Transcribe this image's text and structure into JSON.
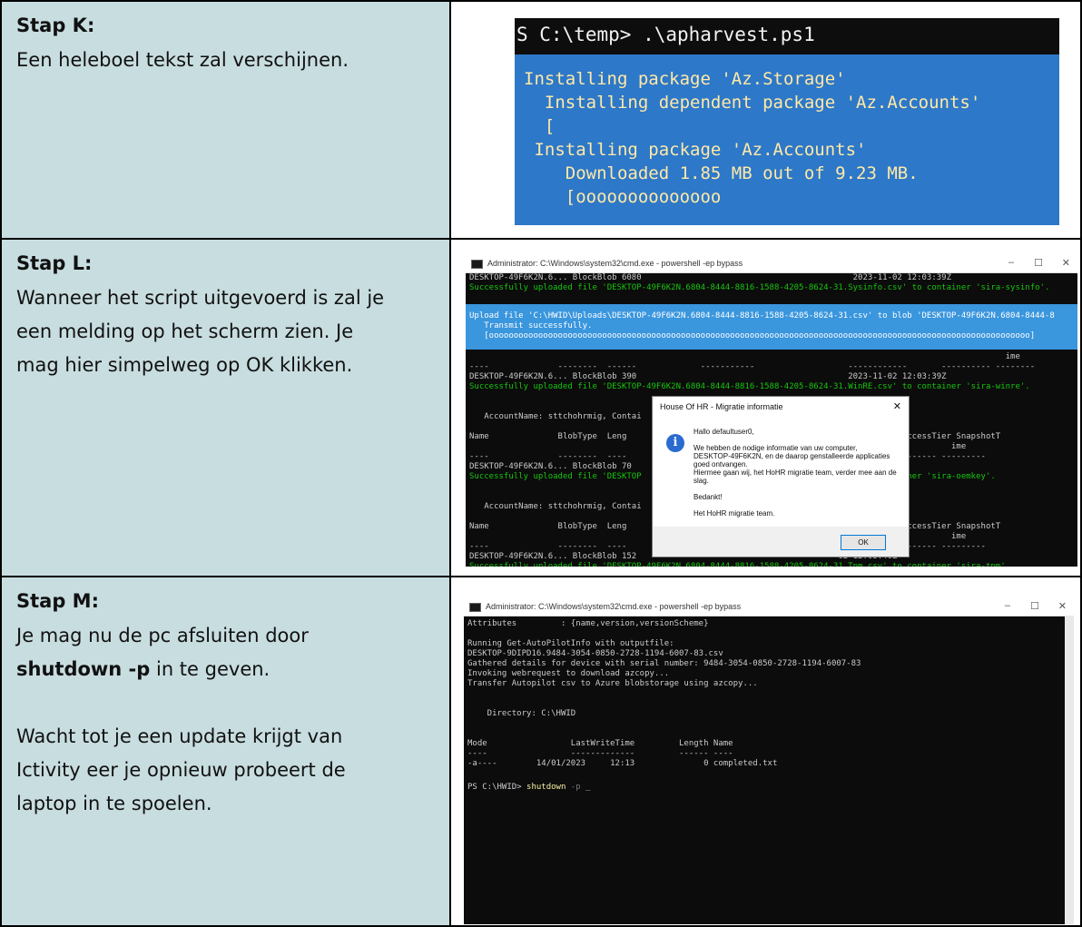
{
  "rows": [
    {
      "title": "Stap K:",
      "text_lines": [
        "Een heleboel tekst zal verschijnen."
      ]
    },
    {
      "title": "Stap L:",
      "text_lines": [
        "Wanneer het script uitgevoerd is zal je",
        "een melding op het scherm zien. Je",
        "mag hier simpelweg op OK klikken."
      ]
    },
    {
      "title": "Stap M:",
      "line1": "Je mag nu de pc afsluiten door",
      "cmd": "shutdown -p",
      "line2_suffix": " in te geven.",
      "para2": [
        "Wacht tot je een update krijgt van",
        "Ictivity eer je opnieuw probeert de",
        "laptop in te spoelen."
      ]
    }
  ],
  "shot_k": {
    "prompt": "S C:\\temp> .\\apharvest.ps1",
    "lines": [
      "Installing package 'Az.Storage'",
      "  Installing dependent package 'Az.Accounts'",
      "  [",
      " Installing package 'Az.Accounts'",
      "    Downloaded 1.85 MB out of 9.23 MB.",
      "    [oooooooooooooo"
    ]
  },
  "shot_l": {
    "window_title": "Administrator: C:\\Windows\\system32\\cmd.exe - powershell  -ep bypass",
    "ctrl": [
      "–",
      "☐",
      "✕"
    ],
    "lines": [
      {
        "t": "DESKTOP-49F6K2N.6... BlockBlob 6080                                           2023-11-02 12:03:39Z",
        "c": "w"
      },
      {
        "t": "Successfully uploaded file 'DESKTOP-49F6K2N.6804-8444-8816-1588-4205-8624-31.Sysinfo.csv' to container 'sira-sysinfo'.",
        "c": "g"
      }
    ],
    "band_lines": [
      "Upload file 'C:\\HWID\\Uploads\\DESKTOP-49F6K2N.6804-8444-8816-1588-4205-8624-31.csv' to blob 'DESKTOP-49F6K2N.6804-8444-8",
      "   Transmit successfully.",
      "   [oooooooooooooooooooooooooooooooooooooooooooooooooooooooooooooooooooooooooooooooooooooooooooooooooooooooooooooo]"
    ],
    "after_lines": [
      {
        "t": "                                                                                                             ime",
        "c": "w"
      },
      {
        "t": "----              --------  ------             -----------                   ------------       ---------- --------",
        "c": "w"
      },
      {
        "t": "DESKTOP-49F6K2N.6... BlockBlob 390                                           2023-11-02 12:03:39Z",
        "c": "w"
      },
      {
        "t": "Successfully uploaded file 'DESKTOP-49F6K2N.6804-8444-8816-1588-4205-8624-31.WinRE.csv' to container 'sira-winre'.",
        "c": "g"
      },
      {
        "t": "",
        "c": "w"
      },
      {
        "t": "",
        "c": "w"
      },
      {
        "t": "   AccountName: sttchohrmig, Contai",
        "c": "w"
      },
      {
        "t": "",
        "c": "w"
      },
      {
        "t": "Name              BlobType  Leng                                           fied         AccessTier SnapshotT",
        "c": "w"
      },
      {
        "t": "                                                                                                  ime",
        "c": "w"
      },
      {
        "t": "----              --------  ----                                         ---------   ---------- ---------",
        "c": "w"
      },
      {
        "t": "DESKTOP-49F6K2N.6... BlockBlob 70                                          02 12:03:39Z",
        "c": "w"
      },
      {
        "t": "Successfully uploaded file 'DESKTOP                                          v' to container 'sira-oemkey'.",
        "c": "g"
      },
      {
        "t": "",
        "c": "w"
      },
      {
        "t": "",
        "c": "w"
      },
      {
        "t": "   AccountName: sttchohrmig, Contai",
        "c": "w"
      },
      {
        "t": "",
        "c": "w"
      },
      {
        "t": "Name              BlobType  Leng                                           fied         AccessTier SnapshotT",
        "c": "w"
      },
      {
        "t": "                                                                                                  ime",
        "c": "w"
      },
      {
        "t": "----              --------  ----                                         ---------   ---------- ---------",
        "c": "w"
      },
      {
        "t": "DESKTOP-49F6K2N.6... BlockBlob 152                                         02 12:03:40Z",
        "c": "w"
      },
      {
        "t": "Successfully uploaded file 'DESKTOP-49F6K2N.6804-8444-8816-1588-4205-8624-31.Tpm.csv' to container 'sira-tpm'.",
        "c": "g"
      }
    ],
    "dialog": {
      "title": "House Of HR - Migratie informatie",
      "close": "✕",
      "icon": "i",
      "msg_lines": [
        "Hallo defaultuser0,",
        "",
        "We hebben de nodige informatie van uw computer,",
        "DESKTOP-49F6K2N, en de daarop genstalleerde applicaties",
        "goed ontvangen.",
        "Hiermee gaan wij, het HoHR migratie team, verder mee aan de",
        "slag.",
        "",
        "Bedankt!",
        "",
        "Het HoHR migratie team."
      ],
      "ok_label": "OK"
    }
  },
  "shot_m": {
    "window_title": "Administrator: C:\\Windows\\system32\\cmd.exe - powershell  -ep bypass",
    "ctrl": [
      "–",
      "☐",
      "✕"
    ],
    "lines": [
      "Attributes         : {name,version,versionScheme}",
      "",
      "Running Get-AutoPilotInfo with outputfile:",
      "DESKTOP-9DIPD16.9484-3054-0850-2728-1194-6007-83.csv",
      "Gathered details for device with serial number: 9484-3054-0850-2728-1194-6007-83",
      "Invoking webrequest to download azcopy...",
      "Transfer Autopilot csv to Azure blobstorage using azcopy...",
      "",
      "",
      "    Directory: C:\\HWID",
      "",
      "",
      "Mode                 LastWriteTime         Length Name",
      "----                 -------------         ------ ----",
      "-a----        14/01/2023     12:13              0 completed.txt",
      ""
    ],
    "prompt": "PS C:\\HWID> ",
    "cmd_word": "shutdown",
    "cmd_arg": " -p ",
    "cursor": "_"
  }
}
